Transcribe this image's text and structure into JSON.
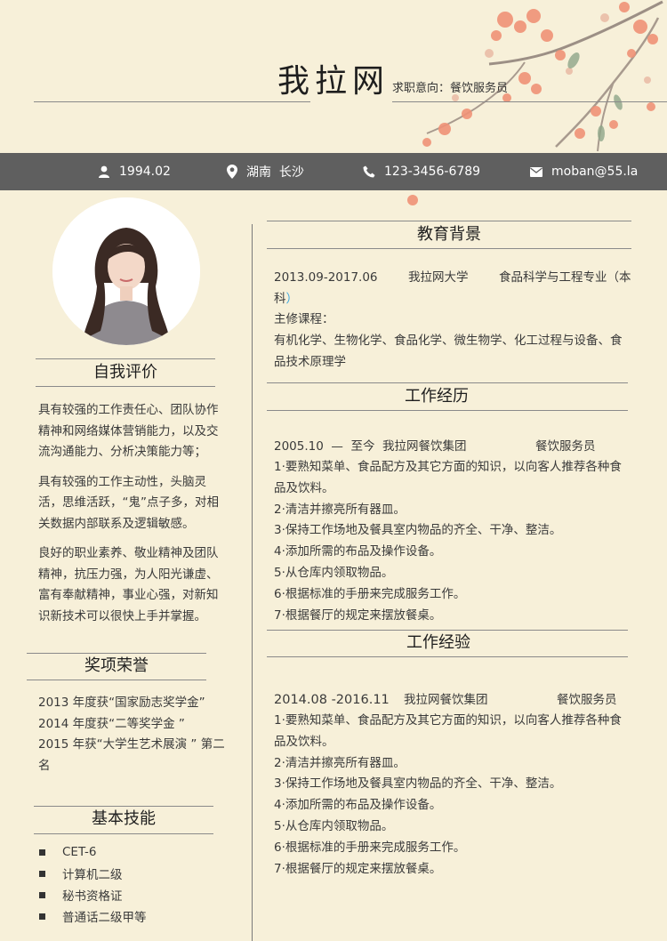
{
  "header": {
    "name": "我拉网",
    "job_intent": "求职意向：餐饮服务员"
  },
  "contact": {
    "birth": "1994.02",
    "location": "湖南  长沙",
    "phone": "123-3456-6789",
    "email": "moban@55.la"
  },
  "icons": [
    "user-icon",
    "location-pin-icon",
    "phone-icon",
    "mail-icon"
  ],
  "colors": {
    "background": "#f7f0d9",
    "contact_bar": "#5f5f5f",
    "accent_paren": "#3aa7e0"
  },
  "self_eval": {
    "title": "自我评价",
    "paragraphs": [
      "具有较强的工作责任心、团队协作精神和网络媒体营销能力，以及交流沟通能力、分析决策能力等；",
      "具有较强的工作主动性，头脑灵活，思维活跃，“鬼”点子多，对相关数据内部联系及逻辑敏感。",
      "良好的职业素养、敬业精神及团队精神，抗压力强，为人阳光谦虚、富有奉献精神，事业心强，对新知识新技术可以很快上手并掌握。"
    ]
  },
  "awards": {
    "title": "奖项荣誉",
    "items": [
      "2013 年度获“国家励志奖学金”",
      "2014 年度获“二等奖学金 ”",
      "2015 年获“大学生艺术展演 ” 第二名"
    ]
  },
  "skills": {
    "title": "基本技能",
    "items": [
      "CET-6",
      "计算机二级",
      "秘书资格证",
      "普通话二级甲等"
    ]
  },
  "education": {
    "title": "教育背景",
    "period": "2013.09-2017.06",
    "school": "我拉网大学",
    "major_prefix": "食品科学与工程专业（本",
    "major_cont": "科",
    "major_close": "）",
    "courses_label": "主修课程：",
    "courses": "有机化学、生物化学、食品化学、微生物学、化工过程与设备、食品技术原理学"
  },
  "work_history": {
    "title": "工作经历",
    "period": "2005.10  —  至今",
    "company": "我拉网餐饮集团",
    "position": "餐饮服务员",
    "duties": [
      "1·要熟知菜单、食品配方及其它方面的知识，以向客人推荐各种食品及饮料。",
      "2·清洁并擦亮所有器皿。",
      "3·保持工作场地及餐具室内物品的齐全、干净、整洁。",
      "4·添加所需的布品及操作设备。",
      "5·从仓库内领取物品。",
      "6·根据标准的手册来完成服务工作。",
      "7·根据餐厅的规定来摆放餐桌。"
    ]
  },
  "work_experience": {
    "title": "工作经验",
    "period": "2014.08 -2016.11",
    "company": "我拉网餐饮集团",
    "position": "餐饮服务员",
    "duties": [
      "1·要熟知菜单、食品配方及其它方面的知识，以向客人推荐各种食品及饮料。",
      "2·清洁并擦亮所有器皿。",
      "3·保持工作场地及餐具室内物品的齐全、干净、整洁。",
      "4·添加所需的布品及操作设备。",
      "5·从仓库内领取物品。",
      "6·根据标准的手册来完成服务工作。",
      "7·根据餐厅的规定来摆放餐桌。"
    ]
  }
}
